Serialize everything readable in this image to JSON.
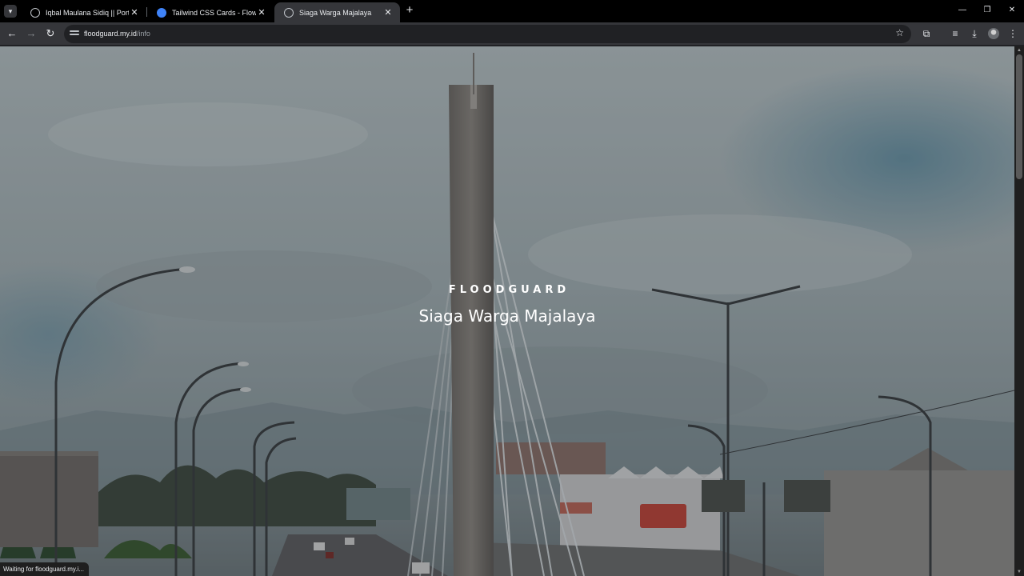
{
  "browser": {
    "tabs": [
      {
        "title": "Iqbal Maulana Sidiq || Portfolio",
        "active": false,
        "favicon": "globe-icon"
      },
      {
        "title": "Tailwind CSS Cards - Flowbite",
        "active": false,
        "favicon": "flowbite-icon"
      },
      {
        "title": "Siaga Warga Majalaya",
        "active": true,
        "favicon": "globe-icon"
      }
    ],
    "url_host": "floodguard.my.id",
    "url_path": "/info",
    "status_text": "Waiting for floodguard.my.i..."
  },
  "hero": {
    "brand": "FLOODGUARD",
    "tagline": "Siaga Warga Majalaya"
  },
  "colors": {
    "chrome_dark": "#202124",
    "toolbar": "#35363a",
    "tab_strip": "#000000",
    "flowbite_blue": "#3f83f8"
  }
}
